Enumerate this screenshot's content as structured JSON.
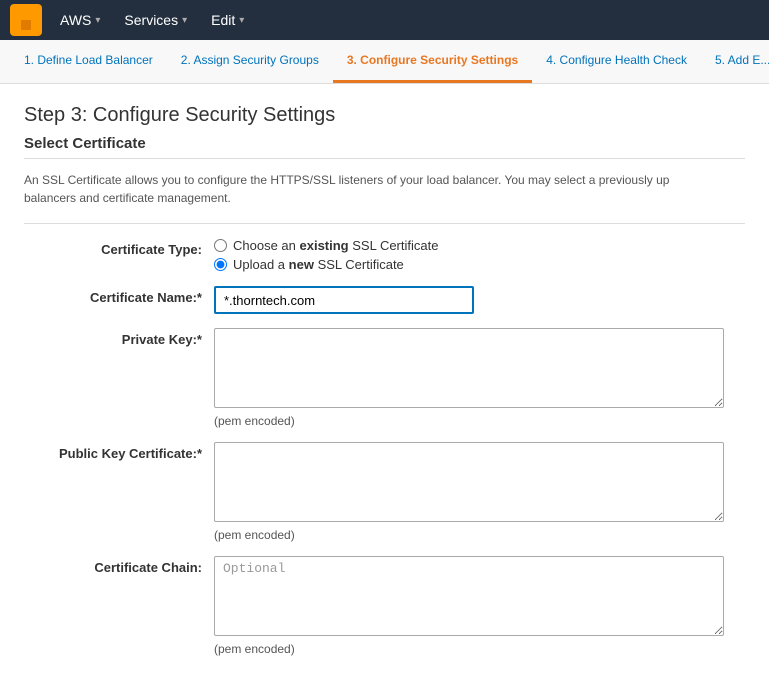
{
  "nav": {
    "logo_alt": "AWS",
    "items": [
      {
        "label": "AWS",
        "id": "aws-menu"
      },
      {
        "label": "Services",
        "id": "services-menu"
      },
      {
        "label": "Edit",
        "id": "edit-menu"
      }
    ]
  },
  "wizard": {
    "tabs": [
      {
        "id": "tab-1",
        "label": "1. Define Load Balancer",
        "active": false
      },
      {
        "id": "tab-2",
        "label": "2. Assign Security Groups",
        "active": false
      },
      {
        "id": "tab-3",
        "label": "3. Configure Security Settings",
        "active": true
      },
      {
        "id": "tab-4",
        "label": "4. Configure Health Check",
        "active": false
      },
      {
        "id": "tab-5",
        "label": "5. Add E...",
        "active": false
      }
    ]
  },
  "page": {
    "title": "Step 3: Configure Security Settings",
    "section_title": "Select Certificate",
    "description_part1": "An SSL Certificate allows you to configure the HTTPS/SSL listeners of your load balancer. You may select a previously up",
    "description_part2": "balancers and certificate management."
  },
  "form": {
    "certificate_type_label": "Certificate Type:",
    "cert_option_existing": "Choose an ",
    "cert_option_existing_bold": "existing",
    "cert_option_existing_suffix": " SSL Certificate",
    "cert_option_new_prefix": "Upload a ",
    "cert_option_new_bold": "new",
    "cert_option_new_suffix": " SSL Certificate",
    "certificate_name_label": "Certificate Name:*",
    "certificate_name_value": "*.thorntech.com",
    "private_key_label": "Private Key:*",
    "private_key_placeholder": "",
    "private_key_hint": "(pem encoded)",
    "public_key_label": "Public Key Certificate:*",
    "public_key_placeholder": "",
    "public_key_hint": "(pem encoded)",
    "chain_label": "Certificate Chain:",
    "chain_placeholder": "Optional",
    "chain_hint": "(pem encoded)"
  },
  "icons": {
    "caret": "▾"
  }
}
